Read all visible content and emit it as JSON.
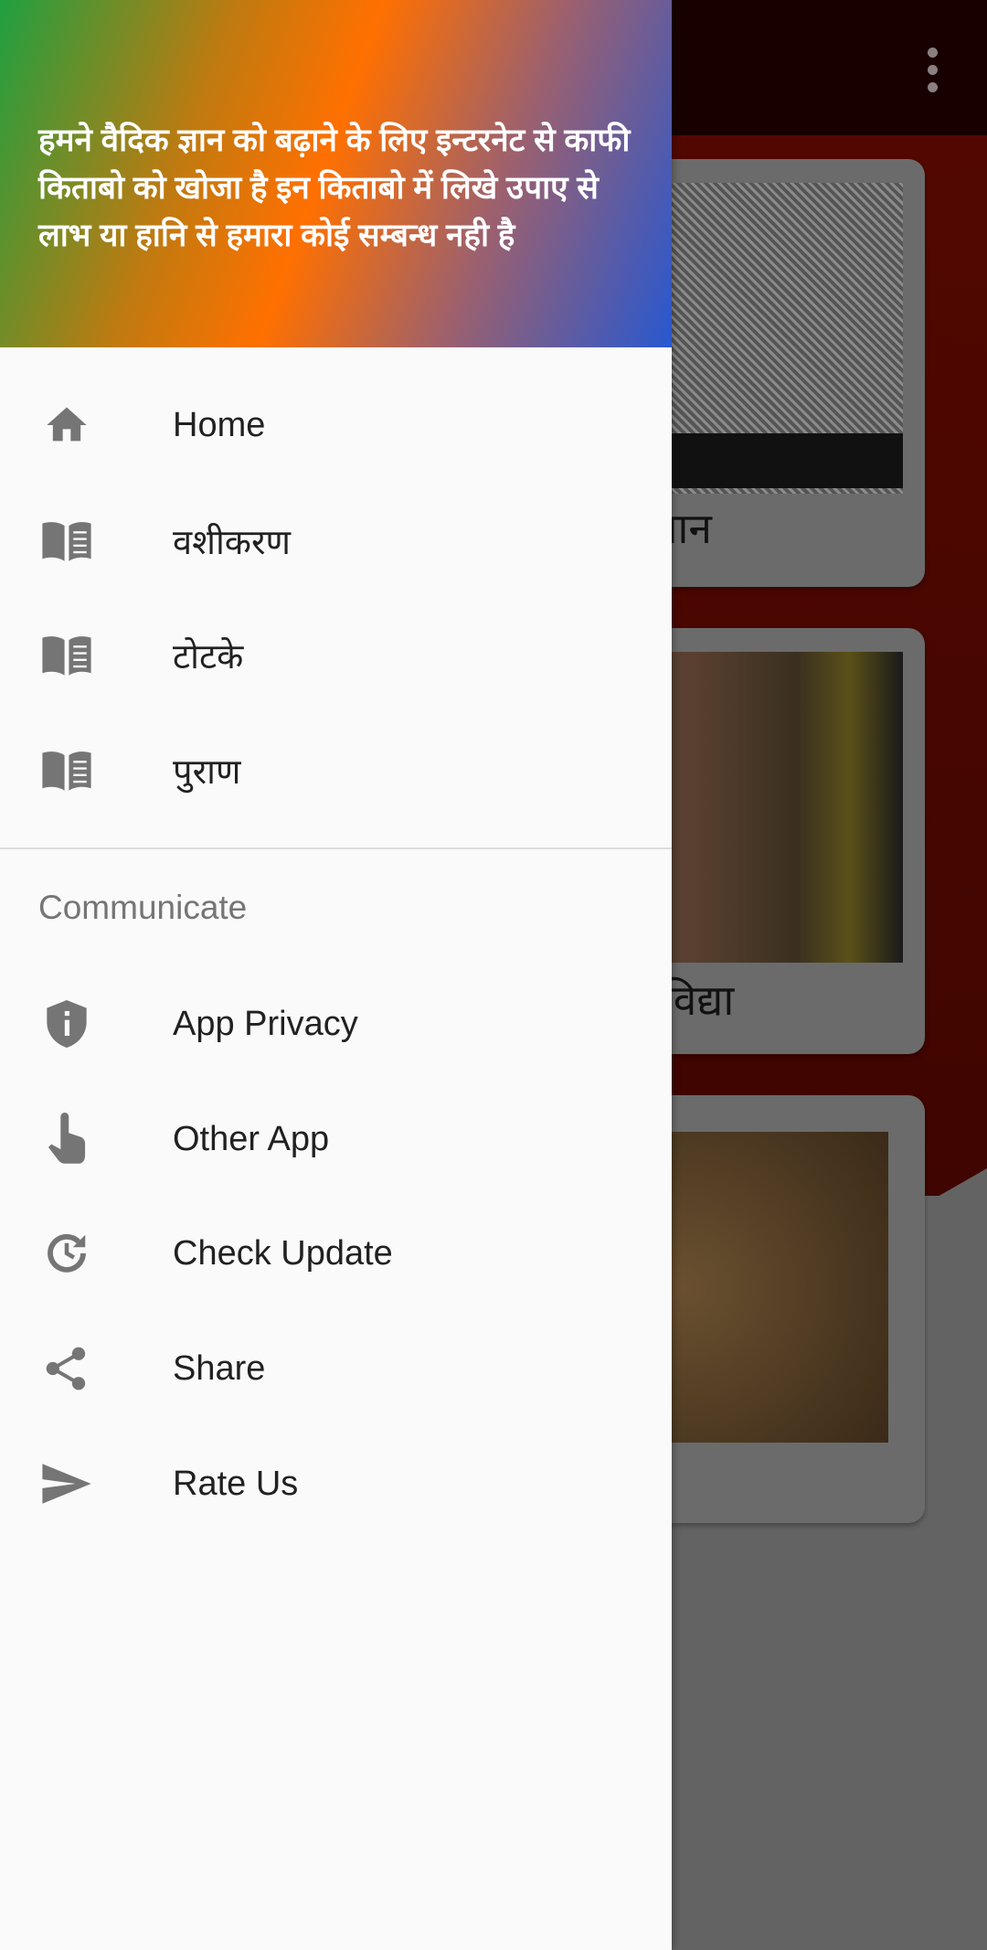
{
  "drawer": {
    "header_text": "हमने वैदिक ज्ञान को बढ़ाने के लिए इन्टरनेट से काफी किताबो को खोजा है इन किताबो में लिखे उपाए से लाभ या हानि से हमारा कोई सम्बन्ध नही है",
    "items": [
      {
        "label": "Home",
        "icon": "home-icon"
      },
      {
        "label": "वशीकरण",
        "icon": "book-icon"
      },
      {
        "label": "टोटके",
        "icon": "book-icon"
      },
      {
        "label": "पुराण",
        "icon": "book-icon"
      }
    ],
    "section_title": "Communicate",
    "communicate": [
      {
        "label": "App Privacy",
        "icon": "shield-info-icon"
      },
      {
        "label": "Other App",
        "icon": "touch-icon"
      },
      {
        "label": "Check Update",
        "icon": "update-icon"
      },
      {
        "label": "Share",
        "icon": "share-icon"
      },
      {
        "label": "Rate Us",
        "icon": "send-icon"
      }
    ]
  },
  "background": {
    "cards": [
      {
        "caption": "ा ज्ञान"
      },
      {
        "caption": "रण विद्या"
      },
      {
        "caption": ""
      }
    ]
  },
  "colors": {
    "icon": "#757575",
    "text": "#212121",
    "drawer_bg": "#fafafa"
  }
}
